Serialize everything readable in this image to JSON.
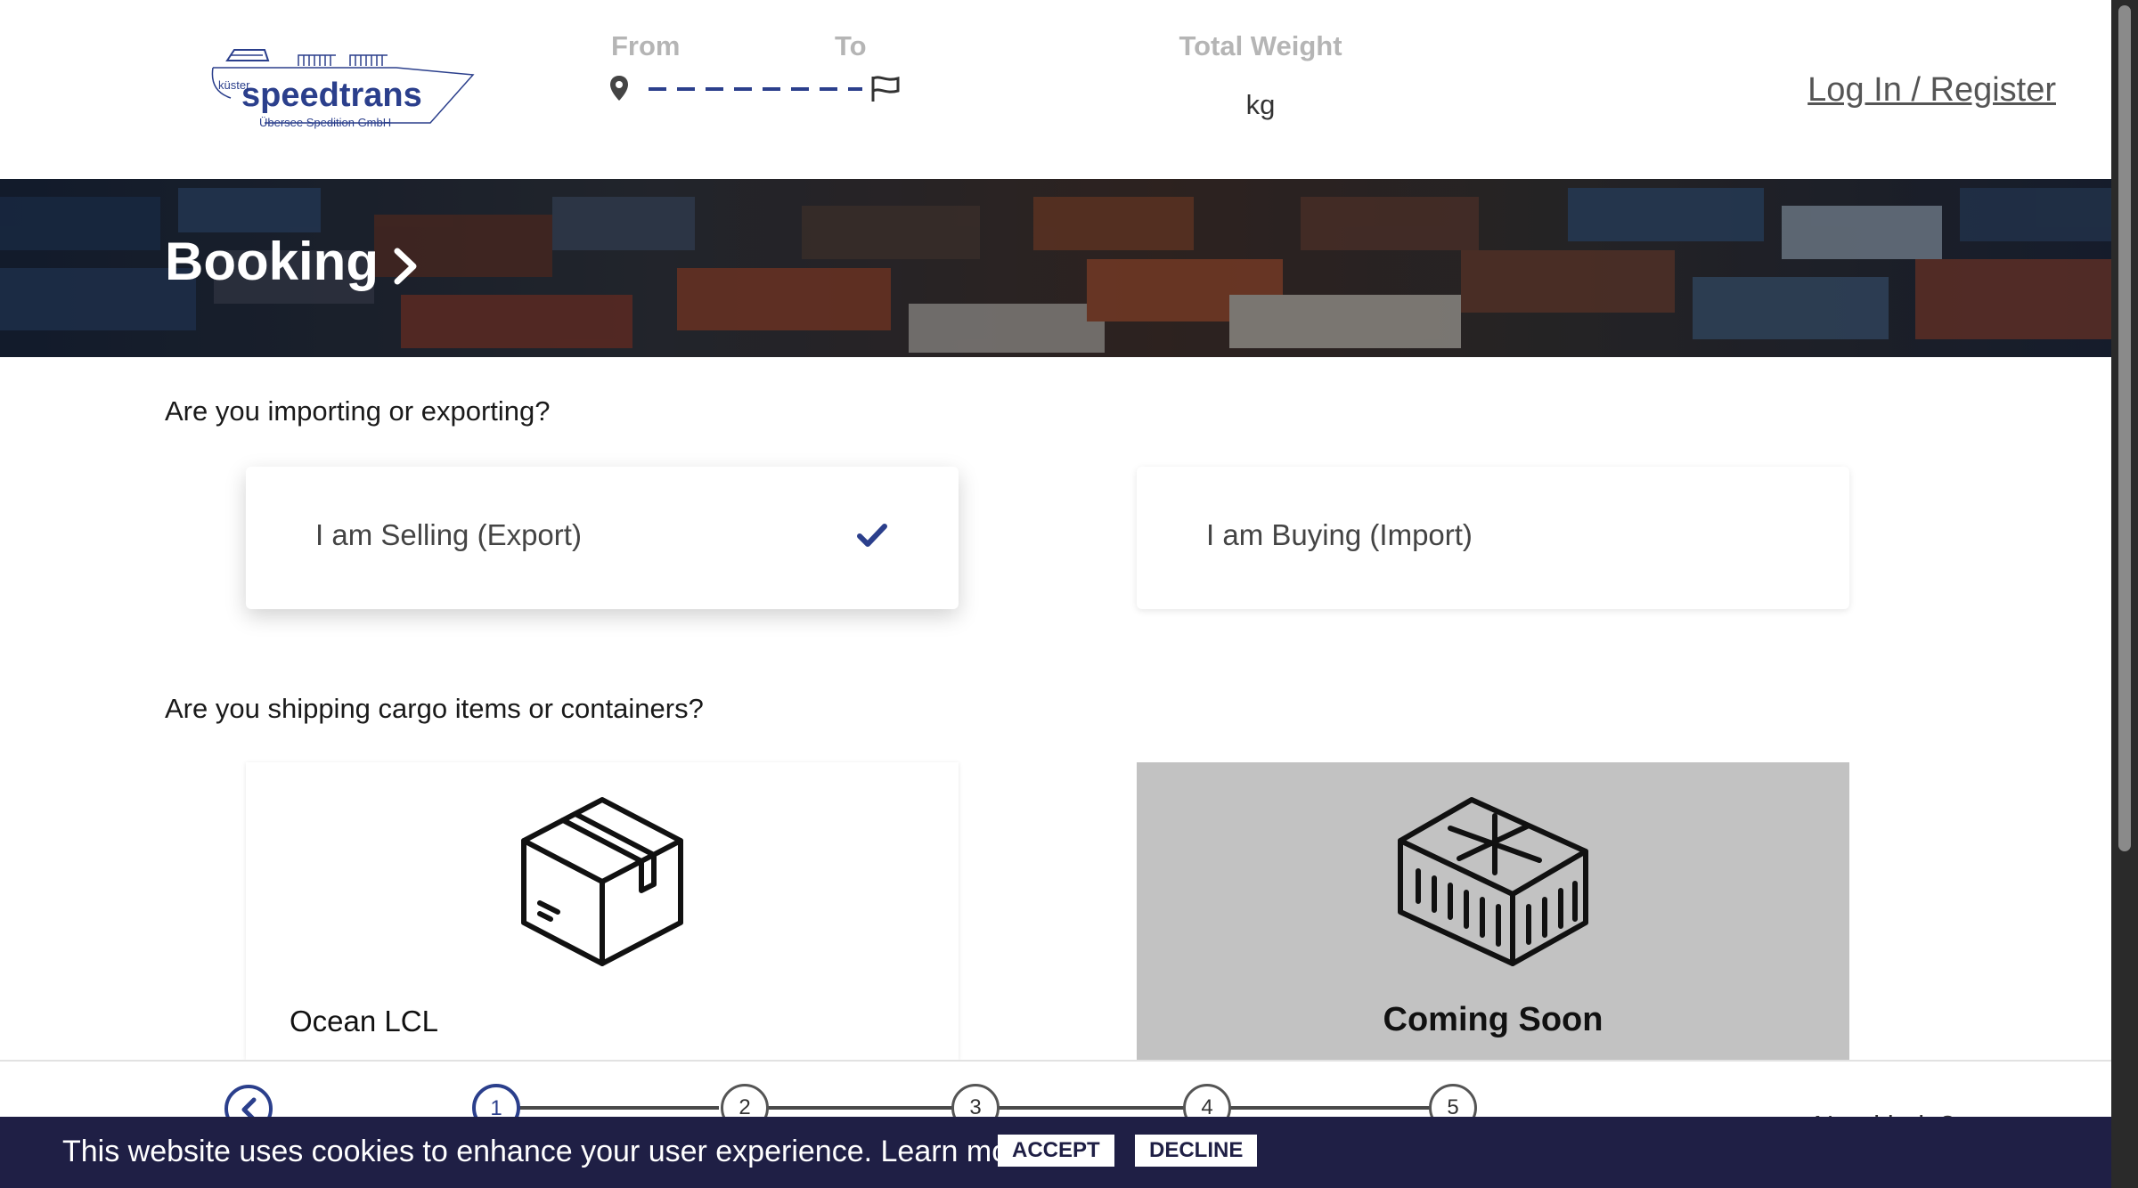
{
  "header": {
    "logo": {
      "brand": "speedtrans",
      "prefix": "küster",
      "tagline": "Übersee Spedition GmbH"
    },
    "route": {
      "from_label": "From",
      "to_label": "To",
      "from_icon": "map-pin-icon",
      "to_icon": "flag-icon"
    },
    "weight": {
      "label": "Total Weight",
      "unit": "kg"
    },
    "login_label": "Log In / Register"
  },
  "banner": {
    "title": "Booking",
    "chevron_icon": "chevron-right-icon"
  },
  "direction": {
    "question": "Are you importing or exporting?",
    "options": [
      {
        "label": "I am Selling (Export)",
        "selected": true
      },
      {
        "label": "I am Buying (Import)",
        "selected": false
      }
    ],
    "check_icon": "checkmark-icon"
  },
  "cargo": {
    "question": "Are you shipping cargo items or containers?",
    "options": [
      {
        "label": "Ocean LCL",
        "icon": "box-icon",
        "available": true
      },
      {
        "label": "Coming Soon",
        "icon": "container-icon",
        "available": false
      }
    ]
  },
  "stepper": {
    "back_icon": "chevron-left-icon",
    "current_step": 1,
    "steps": [
      "1",
      "2",
      "3",
      "4",
      "5"
    ],
    "help_text": "Need help?"
  },
  "cookie": {
    "message": "This website uses cookies to enhance your user experience. Learn more",
    "accept_label": "ACCEPT",
    "decline_label": "DECLINE"
  },
  "colors": {
    "brand_blue": "#2b3f8c",
    "cookie_bar": "#1f1f45",
    "disabled_tile": "#c2c2c2",
    "label_gray": "#b5b5b5"
  }
}
